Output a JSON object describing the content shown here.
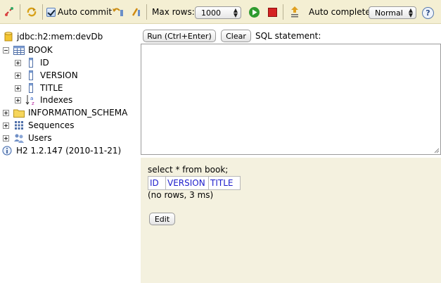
{
  "toolbar": {
    "auto_commit_label": "Auto commit",
    "auto_commit_checked": true,
    "max_rows_label": "Max rows:",
    "max_rows_value": "1000",
    "auto_complete_label": "Auto complete",
    "auto_complete_value": "Normal",
    "help_label": "?"
  },
  "tree": {
    "connection": "jdbc:h2:mem:devDb",
    "table": "BOOK",
    "columns": [
      "ID",
      "VERSION",
      "TITLE"
    ],
    "indexes": "Indexes",
    "schema": "INFORMATION_SCHEMA",
    "sequences": "Sequences",
    "users": "Users",
    "version": "H2 1.2.147 (2010-11-21)"
  },
  "query": {
    "run_label": "Run (Ctrl+Enter)",
    "clear_label": "Clear",
    "statement_label": "SQL statement:",
    "sql_text": ""
  },
  "result": {
    "statement": "select * from book;",
    "columns": [
      "ID",
      "VERSION",
      "TITLE"
    ],
    "summary": "(no rows, 3 ms)",
    "edit_label": "Edit"
  },
  "colors": {
    "toolbar_bg": "#f4efd3",
    "result_bg": "#f4f1df",
    "header_link": "#1d1dcc"
  }
}
